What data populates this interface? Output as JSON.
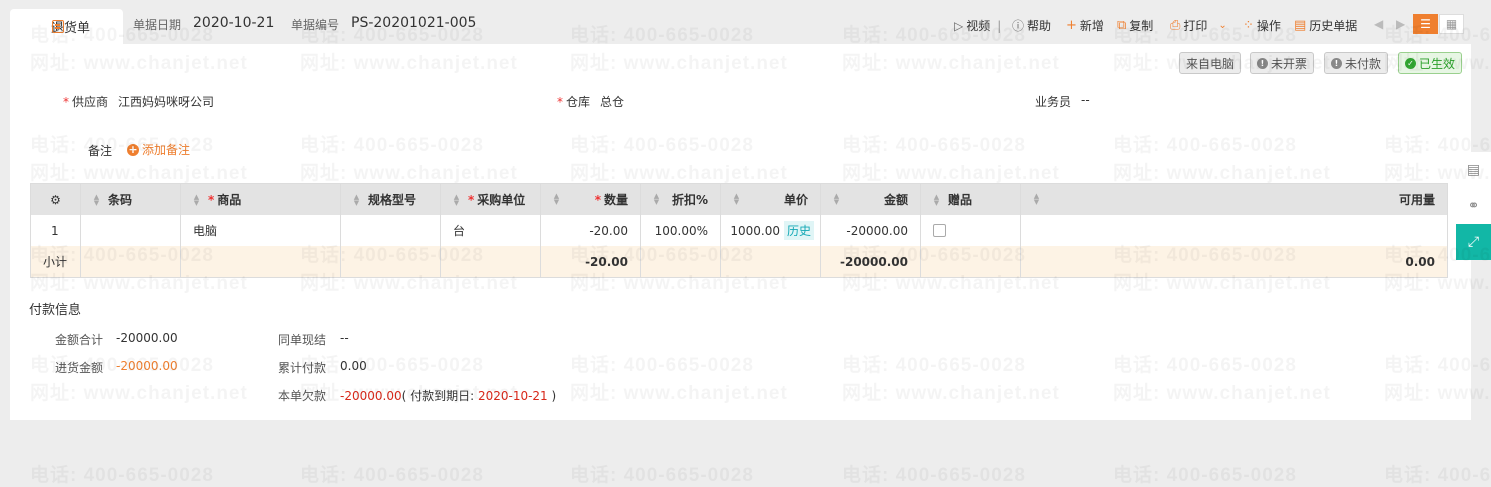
{
  "tab": {
    "label": "退货单",
    "icon": "document-icon"
  },
  "meta": {
    "date_label": "单据日期",
    "date_value": "2020-10-21",
    "no_label": "单据编号",
    "no_value": "PS-20201021-005"
  },
  "toolbar": {
    "video": "视频",
    "help": "帮助",
    "add": "新增",
    "copy": "复制",
    "print": "打印",
    "ops": "操作",
    "history": "历史单据"
  },
  "status": {
    "source": "来自电脑",
    "invoice": "未开票",
    "payment": "未付款",
    "effective": "已生效"
  },
  "fields": {
    "supplier_label": "供应商",
    "supplier_value": "江西妈妈咪呀公司",
    "warehouse_label": "仓库",
    "warehouse_value": "总仓",
    "salesman_label": "业务员",
    "salesman_value": "--",
    "note_label": "备注",
    "add_note": "添加备注"
  },
  "table": {
    "headers": [
      "条码",
      "商品",
      "规格型号",
      "采购单位",
      "数量",
      "折扣%",
      "单价",
      "金额",
      "赠品",
      "可用量"
    ],
    "rows": [
      {
        "index": "1",
        "barcode": "",
        "product": "电脑",
        "spec": "",
        "unit": "台",
        "qty": "-20.00",
        "discount": "100.00%",
        "price": "1000.00",
        "price_tag": "历史",
        "amount": "-20000.00",
        "free": "",
        "available": ""
      }
    ],
    "subtotal": {
      "label": "小计",
      "qty": "-20.00",
      "amount": "-20000.00",
      "available": "0.00"
    }
  },
  "payment": {
    "title": "付款信息",
    "total_label": "金额合计",
    "total_value": "-20000.00",
    "purchase_label": "进货金额",
    "purchase_value": "-20000.00",
    "cash_label": "同单现结",
    "cash_value": "--",
    "paid_label": "累计付款",
    "paid_value": "0.00",
    "owe_label": "本单欠款",
    "owe_value": "-20000.00",
    "due_prefix": "( 付款到期日: ",
    "due_date": "2020-10-21",
    "due_suffix": " )"
  },
  "watermark": {
    "phone": "电话: 400-665-0028",
    "site": "网址: www.chanjet.net"
  },
  "colors": {
    "accent": "#ef7f2f",
    "teal": "#12b7a6",
    "negative": "#d8281a",
    "green": "#33a833"
  }
}
